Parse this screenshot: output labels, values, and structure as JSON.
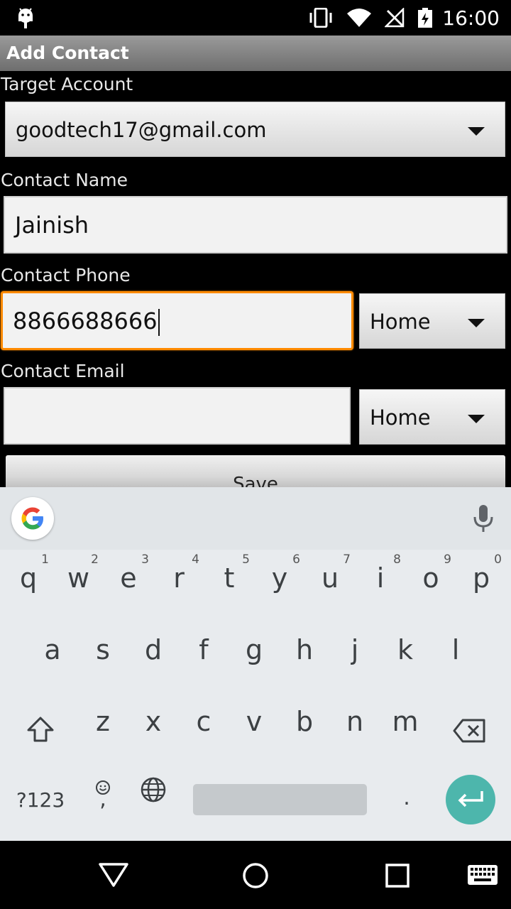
{
  "status_bar": {
    "time": "16:00"
  },
  "action_bar": {
    "title": "Add Contact"
  },
  "form": {
    "target_account_label": "Target Account",
    "target_account_value": "goodtech17@gmail.com",
    "contact_name_label": "Contact Name",
    "contact_name_value": "Jainish",
    "contact_phone_label": "Contact Phone",
    "contact_phone_value": "8866688666",
    "phone_type": "Home",
    "contact_email_label": "Contact Email",
    "contact_email_value": "",
    "email_type": "Home",
    "save_label": "Save"
  },
  "keyboard": {
    "row1": [
      "q",
      "w",
      "e",
      "r",
      "t",
      "y",
      "u",
      "i",
      "o",
      "p"
    ],
    "row1_hints": [
      "1",
      "2",
      "3",
      "4",
      "5",
      "6",
      "7",
      "8",
      "9",
      "0"
    ],
    "row2": [
      "a",
      "s",
      "d",
      "f",
      "g",
      "h",
      "j",
      "k",
      "l"
    ],
    "row3": [
      "z",
      "x",
      "c",
      "v",
      "b",
      "n",
      "m"
    ],
    "symbols_label": "?123",
    "comma": ",",
    "period": "."
  },
  "colors": {
    "focus_border": "#ff8a00",
    "enter_key": "#4db6ac"
  }
}
